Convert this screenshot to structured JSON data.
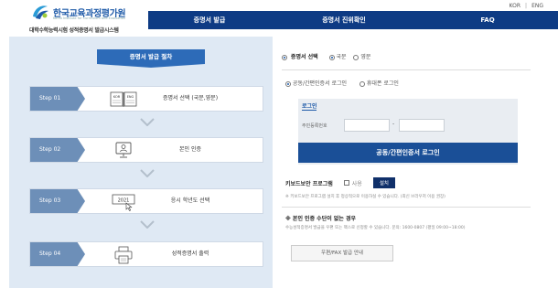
{
  "lang": {
    "kor": "KOR",
    "sep": "|",
    "eng": "ENG"
  },
  "logo": {
    "title": "한국교육과정평가원",
    "sub": "Korea Institute for Curriculum and Evaluation",
    "system": "대학수학능력시험 성적증명서 발급시스템"
  },
  "nav": [
    "증명서 발급",
    "증명서 진위확인",
    "FAQ"
  ],
  "procedure": {
    "title": "증명서 발급 절차",
    "steps": [
      {
        "label": "Step 01",
        "text": "증명서 선택 (국문,영문)",
        "icon": "book-icon",
        "icon_text": "KOR | ENG"
      },
      {
        "label": "Step 02",
        "text": "본인 인증",
        "icon": "monitor-user-icon"
      },
      {
        "label": "Step 03",
        "text": "응시 학년도 선택",
        "icon": "calendar-click-icon",
        "icon_text": "2021"
      },
      {
        "label": "Step 04",
        "text": "성적증명서 출력",
        "icon": "printer-icon"
      }
    ]
  },
  "cert": {
    "label": "증명서 선택",
    "options": [
      "국문",
      "영문"
    ],
    "selected": "국문"
  },
  "auth": {
    "options": [
      "공동/간편인증서 로그인",
      "휴대폰 로그인"
    ],
    "selected": "공동/간편인증서 로그인"
  },
  "login": {
    "title": "로그인",
    "field_label": "주민등록번호",
    "dash": "-",
    "button": "공동/간편인증서 로그인"
  },
  "keyboard": {
    "label": "키보드보안 프로그램",
    "check_label": "사용",
    "setup": "설치",
    "note": "※ 키보드보안 프로그램 설치 후 정상적으로 이용하실 수 있습니다. (최신 브라우저 이용 권장)"
  },
  "noauth": {
    "title": "※ 본인 인증 수단이 없는 경우",
    "text": "수능성적증명서 발급을 우편 또는 팩스로 신청할 수 있습니다. 문의: 1600-0807 (평일 09:00~18:00)",
    "button": "우편/FAX 발급 안내"
  },
  "colors": {
    "nav_bg": "#0e3b84",
    "panel_bg": "#dfe9f4",
    "step_label_bg": "#6d8fb8",
    "login_btn": "#1a4f97"
  }
}
